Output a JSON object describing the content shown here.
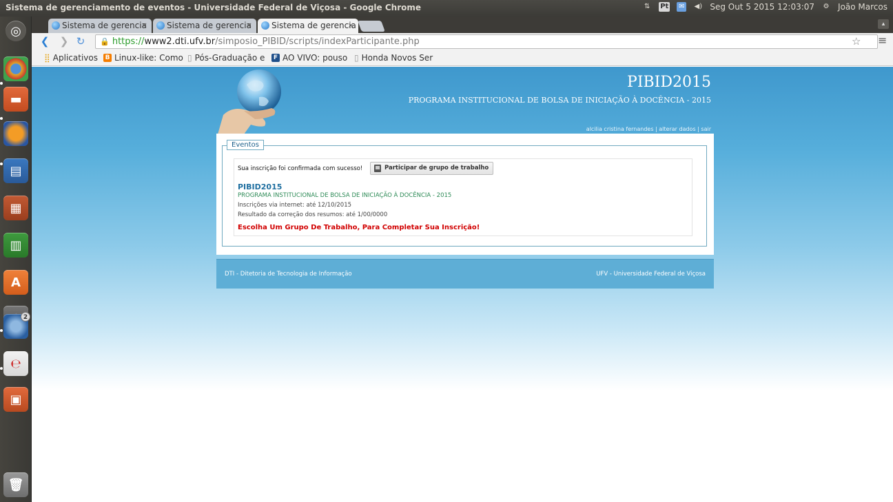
{
  "system": {
    "window_title": "Sistema de gerenciamento de eventos - Universidade Federal de Viçosa - Google Chrome",
    "tray": {
      "pt": "Pt",
      "datetime": "Seg Out 5 2015 12:03:07",
      "user": "João Marcos"
    },
    "launcher_badge": "2"
  },
  "tabs": [
    {
      "label": "Sistema de gerencia",
      "close": "×"
    },
    {
      "label": "Sistema de gerencia",
      "close": "×"
    },
    {
      "label": "Sistema de gerencia",
      "close": "×"
    }
  ],
  "toolbar": {
    "url_scheme": "https://",
    "url_host": "www2.dti.ufv.br",
    "url_path": "/simposio_PIBID/scripts/indexParticipante.php"
  },
  "bookmarks": [
    {
      "label": "Aplicativos"
    },
    {
      "label": "Linux-like: Como"
    },
    {
      "label": "Pós-Graduação e"
    },
    {
      "label": "AO VIVO: pouso"
    },
    {
      "label": "Honda Novos Ser"
    }
  ],
  "site": {
    "title": "PIBID2015",
    "subtitle": "PROGRAMA INSTITUCIONAL DE BOLSA DE INICIAÇÃO À DOCÊNCIA - 2015",
    "user_name": "alcilia cristina fernandes",
    "separator": "|",
    "edit_link": "alterar dados",
    "logout_link": "sair"
  },
  "events": {
    "legend": "Eventos",
    "confirmation": "Sua inscrição foi confirmada com sucesso!",
    "group_button": "Participar de grupo de trabalho",
    "event_name": "PIBID2015",
    "event_full_name": "PROGRAMA INSTITUCIONAL DE BOLSA DE INICIAÇÃO À DOCÊNCIA - 2015",
    "registration": "Inscrições via internet: até 12/10/2015",
    "results": "Resultado da correção dos resumos: até 1/00/0000",
    "warning": "Escolha Um Grupo De Trabalho, Para Completar Sua Inscrição!"
  },
  "footer": {
    "left": "DTI - Ditetoria de Tecnologia de Informação",
    "right": "UFV - Universidade Federal de Viçosa"
  }
}
